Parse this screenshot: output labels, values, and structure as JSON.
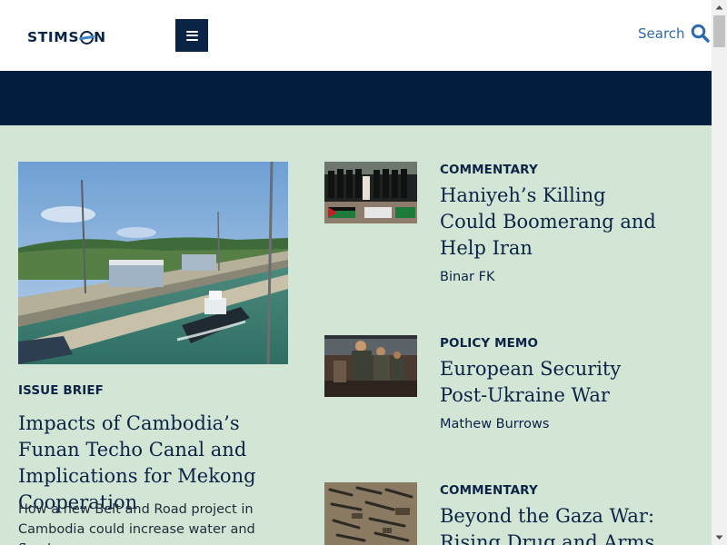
{
  "header": {
    "logo_text_before": "STIMS",
    "logo_text_after": "N",
    "search_label": "Search"
  },
  "feature": {
    "type": "ISSUE BRIEF",
    "title": "Impacts of Cambodia’s Funan Techo Canal and Implications for Mekong Cooperation",
    "description": "How a new Belt and Road project in Cambodia could increase water and flood"
  },
  "articles": [
    {
      "type": "COMMENTARY",
      "title": "Haniyeh’s Killing Could Boomerang and Help Iran",
      "author": "Binar FK"
    },
    {
      "type": "POLICY MEMO",
      "title": "European Security Post-Ukraine War",
      "author": "Mathew Burrows"
    },
    {
      "type": "COMMENTARY",
      "title": "Beyond the Gaza War: Rising Drug and Arms",
      "author": ""
    }
  ],
  "colors": {
    "navy": "#0b2345",
    "banner": "#021d3d",
    "background": "#d3e6d6",
    "link_blue": "#2a6ab1"
  }
}
